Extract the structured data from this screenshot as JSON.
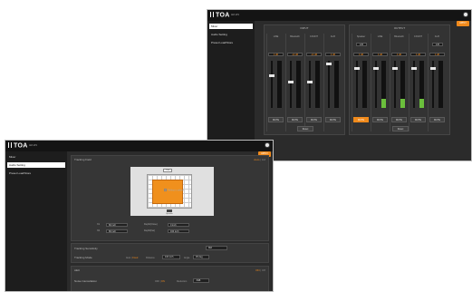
{
  "app": {
    "logo": "TOA",
    "model": "AM-1P1"
  },
  "nav": [
    "Mixer",
    "Audio Setting",
    "Preset Load/Store"
  ],
  "apply_label": "APPLY",
  "mixer": {
    "input_title": "INPUT",
    "output_title": "OUTPUT",
    "input_channels": [
      {
        "name": "LINE",
        "signal": "",
        "value": "0 dB",
        "fader": 0.7,
        "meter": 0,
        "mute": "MUTE",
        "muted": false
      },
      {
        "name": "Bluetooth",
        "signal": "",
        "value": "-10 dB",
        "fader": 0.55,
        "meter": 0,
        "mute": "MUTE",
        "muted": false
      },
      {
        "name": "COUNT",
        "signal": "",
        "value": "-10 dB",
        "fader": 0.55,
        "meter": 0,
        "mute": "MUTE",
        "muted": false
      },
      {
        "name": "AUX",
        "signal": "",
        "value": "0 dB",
        "fader": 0.95,
        "meter": 0,
        "mute": "MUTE",
        "muted": false
      }
    ],
    "output_channels": [
      {
        "name": "Speaker",
        "signal": "F/B",
        "value": "0 dB",
        "fader": 0.85,
        "meter": 0,
        "mute": "MUTE",
        "muted": true
      },
      {
        "name": "LINE",
        "signal": "",
        "value": "0 dB",
        "fader": 0.85,
        "meter": 0.2,
        "mute": "MUTE",
        "muted": false
      },
      {
        "name": "Bluetooth",
        "signal": "",
        "value": "0 dB",
        "fader": 0.85,
        "meter": 0.2,
        "mute": "MUTE",
        "muted": false
      },
      {
        "name": "COUNT",
        "signal": "",
        "value": "0 dB",
        "fader": 0.85,
        "meter": 0.2,
        "mute": "MUTE",
        "muted": false
      },
      {
        "name": "AUX",
        "signal": "F/B",
        "value": "0 dB",
        "fader": 0.85,
        "meter": 0,
        "mute": "MUTE",
        "muted": false
      }
    ],
    "reset_label": "Reset"
  },
  "audio": {
    "tracking_field": {
      "title": "Tracking Field",
      "switch": {
        "auto": "Auto",
        "manual": "Ltd"
      },
      "camera_label": "Cam",
      "speaker_label": "Speaker",
      "checkbox_label": "Reflect in others",
      "fields": [
        {
          "label": "X1",
          "value": "80 inch"
        },
        {
          "label": "X2",
          "value": "80 inch"
        },
        {
          "label": "Depth(Close)",
          "value": "0 inch"
        },
        {
          "label": "Depth(Far)",
          "value": "160 inch"
        }
      ]
    },
    "tracking_sensitivity": {
      "label": "Tracking Sensitivity",
      "value": "Mid"
    },
    "tracking_mode": {
      "label": "Tracking Mode",
      "opt_auto": "Auto",
      "opt_fixed": "Fixed",
      "distance_label": "Distance",
      "distance_value": "100 inch",
      "angle_label": "Angle",
      "angle_value": "45 deg"
    },
    "aec": {
      "title": "AEC",
      "on": "ON",
      "off": "Off"
    },
    "noise": {
      "label": "Noise Cancellation",
      "opt_off": "OFF",
      "opt_on": "ON",
      "level_label": "Reduction",
      "level_value": "-5dB"
    }
  }
}
